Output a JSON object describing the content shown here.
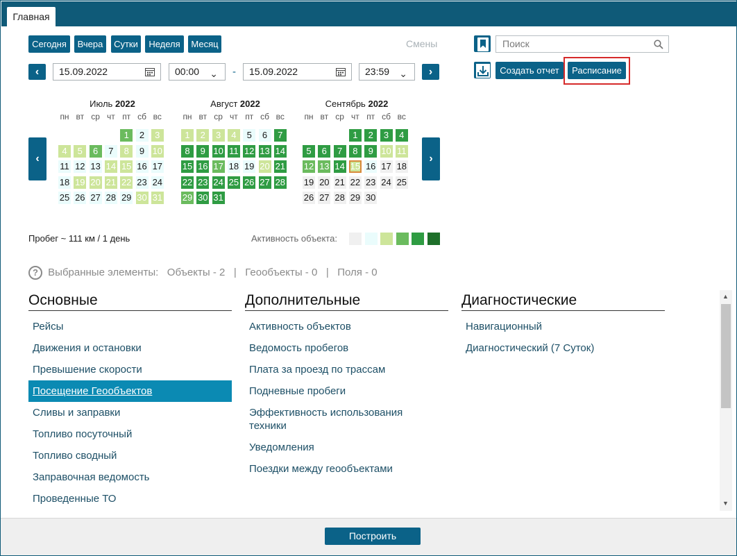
{
  "tab": {
    "label": "Главная"
  },
  "period_buttons": [
    "Сегодня",
    "Вчера",
    "Сутки",
    "Неделя",
    "Месяц"
  ],
  "shifts_label": "Смены",
  "date_from": {
    "date": "15.09.2022",
    "time": "00:00"
  },
  "date_sep": "-",
  "date_to": {
    "date": "15.09.2022",
    "time": "23:59"
  },
  "search": {
    "placeholder": "Поиск"
  },
  "actions": {
    "create_report": "Создать отчет",
    "schedule": "Расписание"
  },
  "calendar": {
    "weekdays": [
      "пн",
      "вт",
      "ср",
      "чт",
      "пт",
      "сб",
      "вс"
    ],
    "months": [
      {
        "name": "Июль",
        "year": "2022",
        "first_weekday": 4,
        "days": 31,
        "levels": [
          3,
          1,
          2,
          2,
          2,
          3,
          1,
          2,
          1,
          2,
          1,
          1,
          1,
          2,
          2,
          1,
          1,
          1,
          2,
          2,
          2,
          2,
          1,
          1,
          1,
          1,
          1,
          1,
          1,
          2,
          2
        ]
      },
      {
        "name": "Август",
        "year": "2022",
        "first_weekday": 0,
        "days": 31,
        "levels": [
          2,
          2,
          2,
          2,
          1,
          1,
          4,
          4,
          4,
          4,
          4,
          4,
          4,
          4,
          4,
          4,
          3,
          1,
          1,
          2,
          4,
          4,
          4,
          4,
          4,
          4,
          4,
          4,
          3,
          4,
          4
        ]
      },
      {
        "name": "Сентябрь",
        "year": "2022",
        "first_weekday": 3,
        "days": 30,
        "levels": [
          4,
          4,
          4,
          4,
          4,
          4,
          4,
          4,
          4,
          2,
          2,
          3,
          3,
          4,
          9,
          1,
          0,
          0,
          0,
          0,
          0,
          0,
          0,
          0,
          0,
          0,
          0,
          0,
          0,
          0
        ]
      }
    ]
  },
  "mileage": "Пробег ~ 111 км / 1 день",
  "activity_label": "Активность объекта:",
  "activity_colors": [
    "#f0f0f0",
    "#eafcfc",
    "#cde59a",
    "#6bbb5e",
    "#2f9c43",
    "#1e6f2a"
  ],
  "selected": {
    "label": "Выбранные элементы:",
    "objects": "Объекты - 2",
    "sep1": "|",
    "geoobjects": "Геообъекты - 0",
    "sep2": "|",
    "fields": "Поля - 0"
  },
  "columns": [
    {
      "title": "Основные",
      "items": [
        "Рейсы",
        "Движения и остановки",
        "Превышение скорости",
        "Посещение Геообъектов",
        "Сливы и заправки",
        "Топливо посуточный",
        "Топливо сводный",
        "Заправочная ведомость",
        "Проведенные ТО"
      ]
    },
    {
      "title": "Дополнительные",
      "items": [
        "Активность объектов",
        "Ведомость пробегов",
        "Плата за проезд по трассам",
        "Подневные пробеги",
        "Эффективность использования техники",
        "Уведомления",
        "Поездки между геообъектами"
      ]
    },
    {
      "title": "Диагностические",
      "items": [
        "Навигационный",
        "Диагностический (7 Суток)"
      ]
    }
  ],
  "selected_report": "Посещение Геообъектов",
  "build_button": "Построить"
}
